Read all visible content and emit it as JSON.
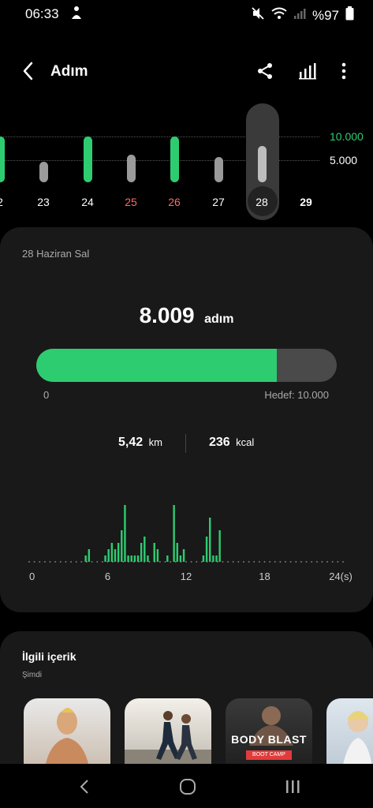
{
  "status_bar": {
    "time": "06:33",
    "battery": "%97"
  },
  "header": {
    "title": "Adım"
  },
  "day_chart": {
    "ref_lines": [
      "10.000",
      "5.000"
    ],
    "days": [
      {
        "label": "2",
        "steps": 10000,
        "goal_met": true,
        "color": "#fff"
      },
      {
        "label": "23",
        "steps": 4500,
        "goal_met": false,
        "color": "#fff"
      },
      {
        "label": "24",
        "steps": 10000,
        "goal_met": true,
        "color": "#fff"
      },
      {
        "label": "25",
        "steps": 6000,
        "goal_met": false,
        "color": "#ff6b6b"
      },
      {
        "label": "26",
        "steps": 10000,
        "goal_met": true,
        "color": "#ff6b6b"
      },
      {
        "label": "27",
        "steps": 5500,
        "goal_met": false,
        "color": "#fff"
      },
      {
        "label": "28",
        "steps": 8009,
        "goal_met": false,
        "color": "#fff",
        "selected": true
      },
      {
        "label": "29",
        "steps": 0,
        "goal_met": false,
        "color": "#fff",
        "bold": true
      }
    ]
  },
  "summary": {
    "date": "28 Haziran Sal",
    "steps_value": "8.009",
    "steps_unit": "adım",
    "progress_fraction": 0.8009,
    "progress_min": "0",
    "goal_label": "Hedef: 10.000",
    "distance_value": "5,42",
    "distance_unit": "km",
    "calories_value": "236",
    "calories_unit": "kcal"
  },
  "chart_data": {
    "type": "bar",
    "x_ticks": [
      "0",
      "6",
      "12",
      "18",
      "24(s)"
    ],
    "xlim": [
      0,
      24
    ],
    "values": [
      0,
      0,
      0,
      0,
      0,
      0,
      0,
      0,
      0,
      0,
      0,
      0,
      0,
      0,
      0,
      0,
      0,
      1,
      2,
      0,
      0,
      0,
      0,
      1,
      2,
      3,
      2,
      3,
      5,
      9,
      1,
      1,
      1,
      1,
      3,
      4,
      1,
      0,
      3,
      2,
      0,
      0,
      1,
      0,
      9,
      3,
      1,
      2,
      0,
      0,
      0,
      0,
      0,
      1,
      4,
      7,
      1,
      1,
      5,
      0,
      0,
      0,
      0,
      0,
      0,
      0,
      0,
      0,
      0,
      0,
      0,
      0,
      0,
      0,
      0,
      0,
      0,
      0,
      0,
      0,
      0,
      0,
      0,
      0,
      0,
      0,
      0,
      0,
      0,
      0,
      0,
      0,
      0,
      0,
      0,
      0
    ],
    "color": "#2ecc71"
  },
  "related": {
    "title": "İlgili içerik",
    "subtitle": "Şimdi",
    "items": [
      {
        "name": "fitness-thumbnail-1",
        "label": ""
      },
      {
        "name": "running-thumbnail",
        "label": ""
      },
      {
        "name": "body-blast-thumbnail",
        "label": "BODY BLAST",
        "sublabel": "BOOT CAMP"
      },
      {
        "name": "fitness-thumbnail-4",
        "label": ""
      }
    ]
  },
  "colors": {
    "accent_green": "#2ecc71",
    "gray_bar": "#9a9a9a"
  }
}
